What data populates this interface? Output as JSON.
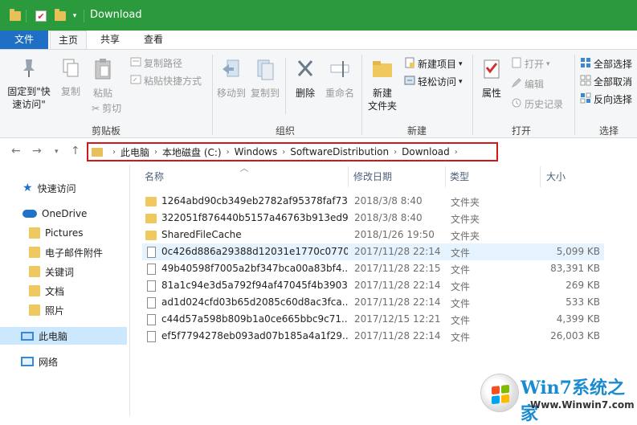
{
  "window": {
    "title": "Download"
  },
  "ribbon_tabs": [
    "文件",
    "主页",
    "共享",
    "查看"
  ],
  "ribbon": {
    "clipboard": {
      "pin_label_line1": "固定到\"快",
      "pin_label_line2": "速访问\"",
      "copy": "复制",
      "paste": "粘贴",
      "copy_path": "复制路径",
      "paste_shortcut": "粘贴快捷方式",
      "cut": "剪切",
      "group": "剪贴板"
    },
    "organize": {
      "move_to": "移动到",
      "copy_to": "复制到",
      "delete": "删除",
      "rename": "重命名",
      "group": "组织"
    },
    "new": {
      "new_folder_line1": "新建",
      "new_folder_line2": "文件夹",
      "new_item": "新建项目",
      "easy_access": "轻松访问",
      "group": "新建"
    },
    "open": {
      "properties": "属性",
      "open": "打开",
      "edit": "编辑",
      "history": "历史记录",
      "group": "打开"
    },
    "select": {
      "select_all": "全部选择",
      "select_none": "全部取消",
      "invert": "反向选择",
      "group": "选择"
    }
  },
  "address": {
    "crumbs": [
      "此电脑",
      "本地磁盘 (C:)",
      "Windows",
      "SoftwareDistribution",
      "Download"
    ]
  },
  "nav_pane": {
    "quick_access": "快速访问",
    "onedrive": "OneDrive",
    "onedrive_items": [
      "Pictures",
      "电子邮件附件",
      "关键词",
      "文档",
      "照片"
    ],
    "this_pc": "此电脑",
    "network": "网络"
  },
  "columns": {
    "name": "名称",
    "date": "修改日期",
    "type": "类型",
    "size": "大小"
  },
  "files": [
    {
      "name": "1264abd90cb349eb2782af95378faf73",
      "date": "2018/3/8 8:40",
      "type": "文件夹",
      "size": "",
      "kind": "folder"
    },
    {
      "name": "322051f876440b5157a46763b913ed93",
      "date": "2018/3/8 8:40",
      "type": "文件夹",
      "size": "",
      "kind": "folder"
    },
    {
      "name": "SharedFileCache",
      "date": "2018/1/26 19:50",
      "type": "文件夹",
      "size": "",
      "kind": "folder"
    },
    {
      "name": "0c426d886a29388d12031e1770c0770...",
      "date": "2017/11/28 22:14",
      "type": "文件",
      "size": "5,099 KB",
      "kind": "file"
    },
    {
      "name": "49b40598f7005a2bf347bca00a83bf4...",
      "date": "2017/11/28 22:15",
      "type": "文件",
      "size": "83,391 KB",
      "kind": "file"
    },
    {
      "name": "81a1c94e3d5a792f94af47045f4b3903...",
      "date": "2017/11/28 22:14",
      "type": "文件",
      "size": "269 KB",
      "kind": "file"
    },
    {
      "name": "ad1d024cfd03b65d2085c60d8ac3fca...",
      "date": "2017/11/28 22:14",
      "type": "文件",
      "size": "533 KB",
      "kind": "file"
    },
    {
      "name": "c44d57a598b809b1a0ce665bbc9c71...",
      "date": "2017/12/15 12:21",
      "type": "文件",
      "size": "4,399 KB",
      "kind": "file"
    },
    {
      "name": "ef5f7794278eb093ad07b185a4a1f29...",
      "date": "2017/11/28 22:14",
      "type": "文件",
      "size": "26,003 KB",
      "kind": "file"
    }
  ],
  "watermark": {
    "title": "Win7系统之家",
    "url": "Www.Winwin7.com"
  }
}
